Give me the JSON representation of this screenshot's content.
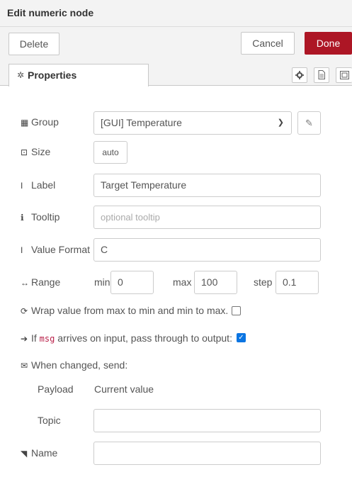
{
  "dialog": {
    "title": "Edit numeric node"
  },
  "buttons": {
    "delete": "Delete",
    "cancel": "Cancel",
    "done": "Done"
  },
  "tabs": {
    "properties": "Properties"
  },
  "form": {
    "group": {
      "label": "Group",
      "value": "[GUI] Temperature"
    },
    "size": {
      "label": "Size",
      "value": "auto"
    },
    "label": {
      "label": "Label",
      "value": "Target Temperature"
    },
    "tooltip": {
      "label": "Tooltip",
      "placeholder": "optional tooltip"
    },
    "value_format": {
      "label": "Value Format",
      "value": "C"
    },
    "range": {
      "label": "Range",
      "min_label": "min",
      "min": "0",
      "max_label": "max",
      "max": "100",
      "step_label": "step",
      "step": "0.1"
    },
    "wrap": {
      "label": "Wrap value from max to min and min to max.",
      "checked": false
    },
    "passthru": {
      "prefix": "If",
      "code": "msg",
      "suffix": "arrives on input, pass through to output:",
      "checked": true
    },
    "when_changed": {
      "label": "When changed, send:"
    },
    "payload": {
      "label": "Payload",
      "value": "Current value"
    },
    "topic": {
      "label": "Topic",
      "value": ""
    },
    "name": {
      "label": "Name",
      "value": ""
    }
  },
  "colors": {
    "done": "#ad1625",
    "checkbox_on": "#0b75e2"
  },
  "icons": [
    "gear-icon",
    "info-doc-icon",
    "node-appearance-icon",
    "table-icon",
    "size-icon",
    "text-cursor-icon",
    "info-circle-icon",
    "arrows-horizontal-icon",
    "refresh-icon",
    "arrow-right-icon",
    "envelope-icon",
    "tag-icon",
    "pencil-icon",
    "chevron-down-icon"
  ]
}
